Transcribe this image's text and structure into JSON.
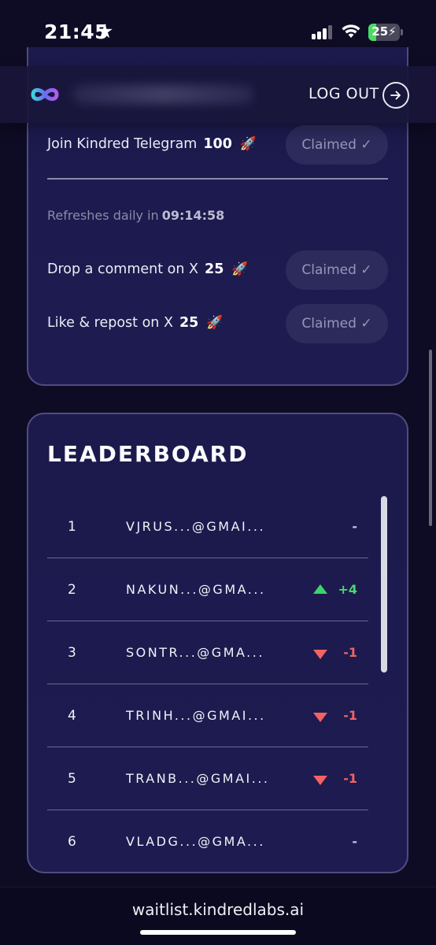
{
  "status_bar": {
    "time": "21:45",
    "battery": "25"
  },
  "header": {
    "logout_label": "LOG OUT"
  },
  "tasks": [
    {
      "label": "Join Kindred Telegram",
      "points": "100",
      "button": "Claimed ✓"
    },
    {
      "label": "Drop a comment on X",
      "points": "25",
      "button": "Claimed ✓"
    },
    {
      "label": "Like & repost on X",
      "points": "25",
      "button": "Claimed ✓"
    }
  ],
  "refresh": {
    "prefix": "Refreshes daily in",
    "countdown": "09:14:58"
  },
  "leaderboard": {
    "title": "LEADERBOARD",
    "rows": [
      {
        "rank": "1",
        "email": "VJRUS...@GMAI...",
        "change": "-"
      },
      {
        "rank": "2",
        "email": "NAKUN...@GMA...",
        "change": "+4"
      },
      {
        "rank": "3",
        "email": "SONTR...@GMA...",
        "change": "-1"
      },
      {
        "rank": "4",
        "email": "TRINH...@GMAI...",
        "change": "-1"
      },
      {
        "rank": "5",
        "email": "TRANB...@GMAI...",
        "change": "-1"
      },
      {
        "rank": "6",
        "email": "VLADG...@GMA...",
        "change": "-"
      }
    ]
  },
  "url_bar": {
    "url": "waitlist.kindredlabs.ai"
  },
  "colors": {
    "background": "#0e0b24",
    "card": "#1c1a4c",
    "up": "#4ad671",
    "down": "#f26363"
  }
}
